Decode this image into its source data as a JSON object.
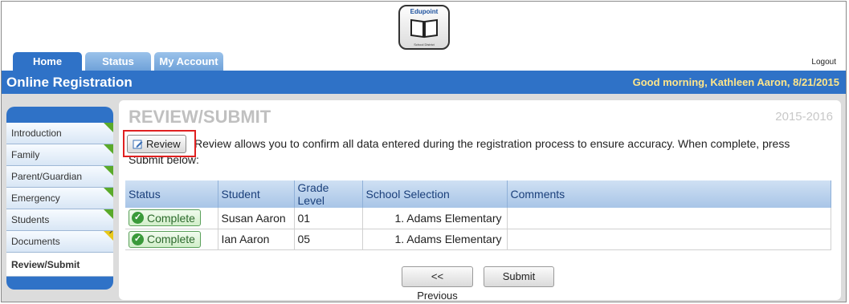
{
  "header": {
    "logo_text": "Edupoint",
    "logo_sub": "School District",
    "tabs": [
      {
        "label": "Home",
        "active": true
      },
      {
        "label": "Status",
        "active": false
      },
      {
        "label": "My Account",
        "active": false
      }
    ],
    "logout_label": "Logout"
  },
  "titlebar": {
    "title": "Online Registration",
    "greeting": "Good morning, Kathleen Aaron, 8/21/2015"
  },
  "sidebar": {
    "items": [
      {
        "label": "Introduction",
        "flag": "green"
      },
      {
        "label": "Family",
        "flag": "green"
      },
      {
        "label": "Parent/Guardian",
        "flag": "green"
      },
      {
        "label": "Emergency",
        "flag": "green"
      },
      {
        "label": "Students",
        "flag": "green"
      },
      {
        "label": "Documents",
        "flag": "yellow"
      },
      {
        "label": "Review/Submit",
        "flag": "none",
        "current": true
      }
    ]
  },
  "main": {
    "heading": "REVIEW/SUBMIT",
    "year": "2015-2016",
    "review_button_label": "Review",
    "instructions": "Review allows you to confirm all data entered during the registration process to ensure accuracy. When complete, press Submit below:",
    "table": {
      "headers": [
        "Status",
        "Student",
        "Grade Level",
        "School Selection",
        "Comments"
      ],
      "rows": [
        {
          "status": "Complete",
          "student": "Susan Aaron",
          "grade": "01",
          "school": "1.  Adams Elementary",
          "comments": ""
        },
        {
          "status": "Complete",
          "student": "Ian Aaron",
          "grade": "05",
          "school": "1.  Adams Elementary",
          "comments": ""
        }
      ]
    },
    "previous_label": "<< Previous",
    "submit_label": "Submit"
  },
  "colors": {
    "brand_blue": "#2f72c7",
    "greeting_yellow": "#ffe68a",
    "complete_green": "#3a9a3a",
    "highlight_red": "#e02020"
  }
}
